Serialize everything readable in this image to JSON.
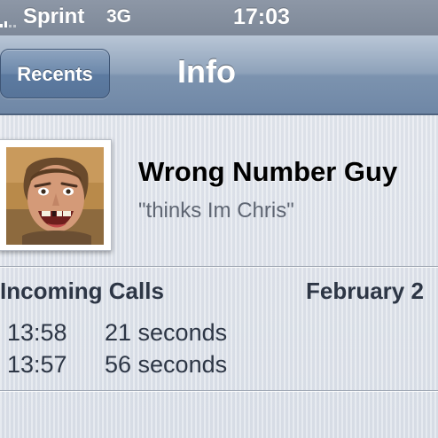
{
  "status_bar": {
    "carrier": "Sprint",
    "network": "3G",
    "time": "17:03"
  },
  "nav": {
    "back_label": "Recents",
    "title": "Info"
  },
  "contact": {
    "name": "Wrong Number Guy",
    "note": "\"thinks Im Chris\""
  },
  "calls": {
    "section_title": "Incoming Calls",
    "date": "February 2",
    "entries": [
      {
        "time": "13:58",
        "duration": "21 seconds"
      },
      {
        "time": "13:57",
        "duration": "56 seconds"
      }
    ]
  },
  "colors": {
    "nav_bar": "#7c93af",
    "status_bar": "#8d97a6",
    "text_dark": "#2d3645",
    "note_gray": "#5f6673"
  }
}
